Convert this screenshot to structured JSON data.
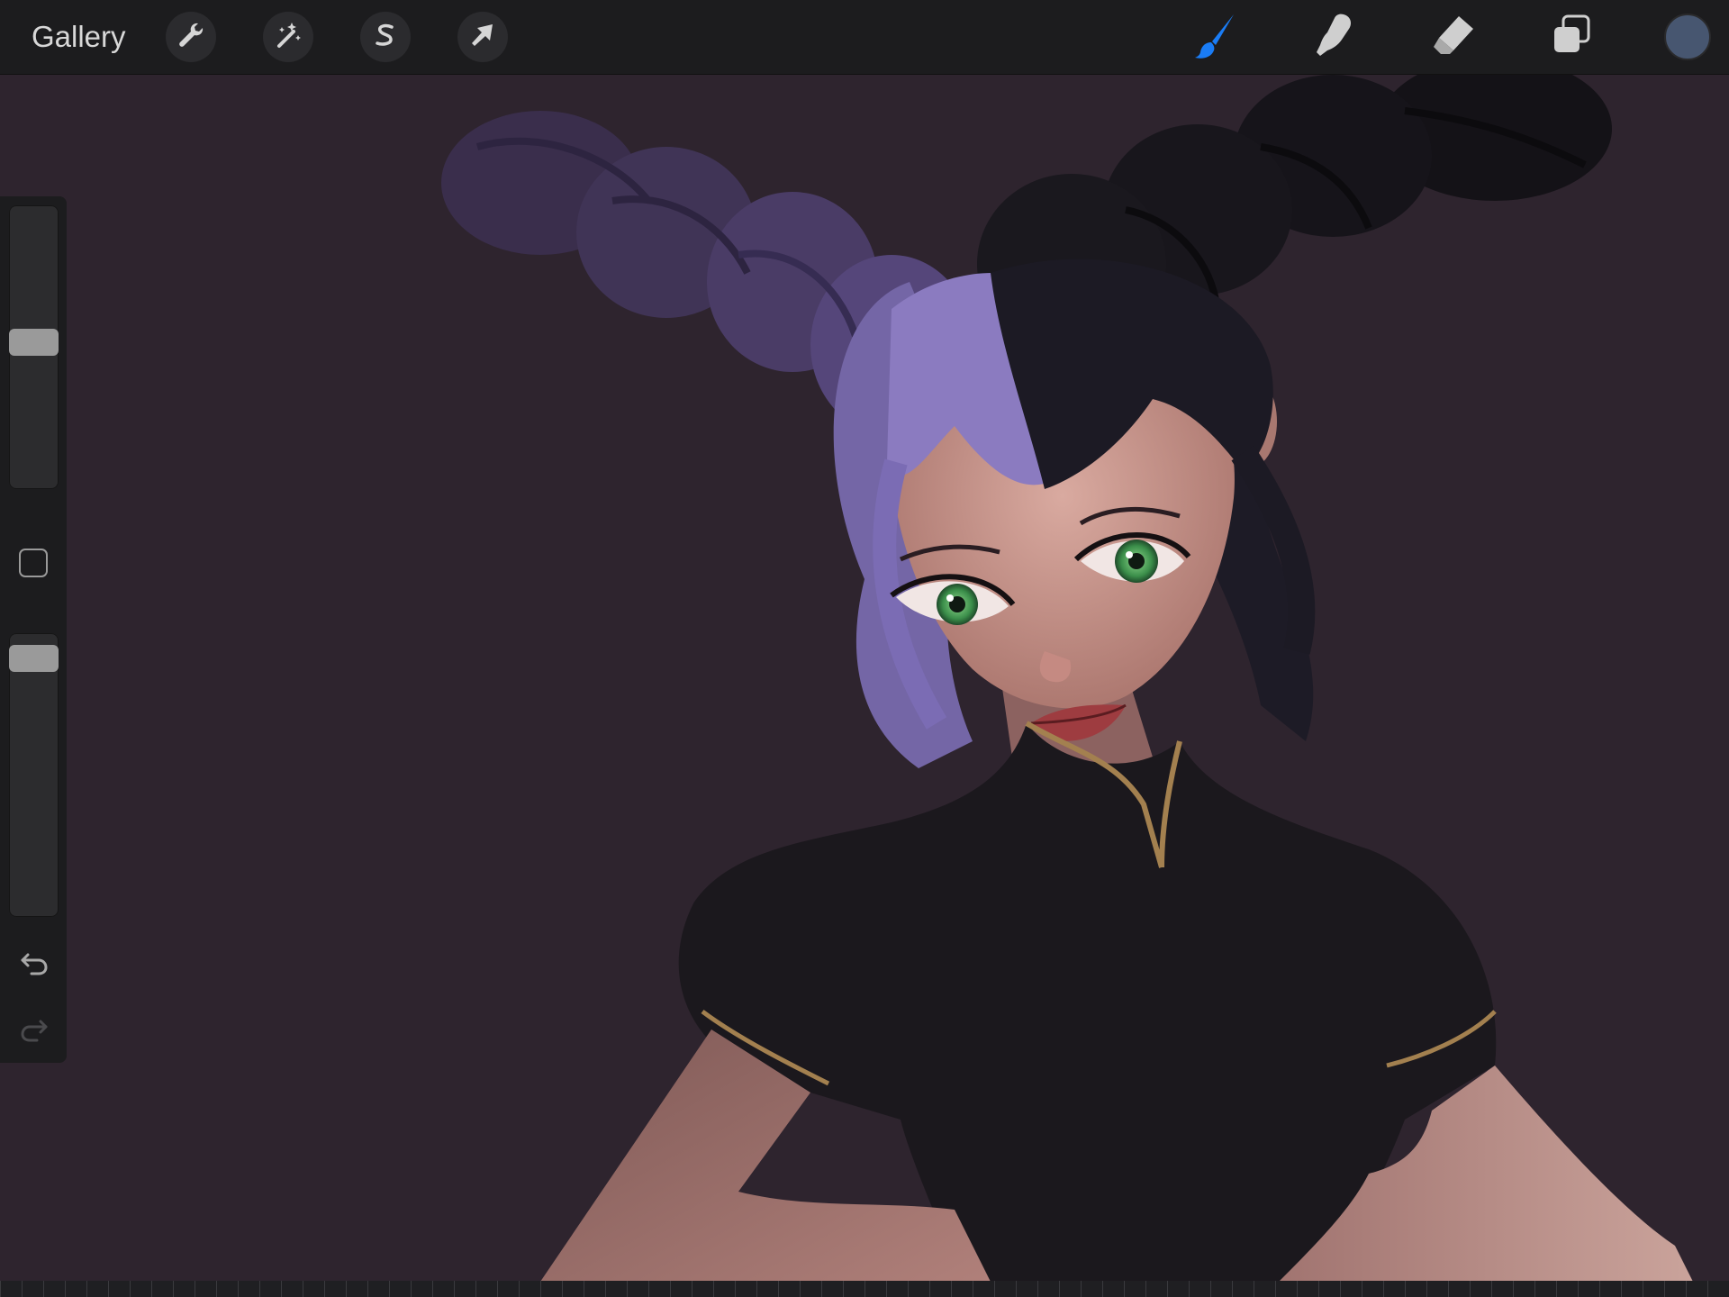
{
  "toolbar": {
    "gallery_label": "Gallery",
    "actions_icon": "wrench-icon",
    "adjustments_icon": "magic-wand-icon",
    "selection_icon": "selection-s-icon",
    "transform_icon": "arrow-cursor-icon",
    "brush_icon": "brush-icon",
    "smudge_icon": "smudge-finger-icon",
    "eraser_icon": "eraser-icon",
    "layers_icon": "layers-icon",
    "active_tool": "brush",
    "active_tool_color": "#1a7cf5",
    "current_color": "#475670"
  },
  "sidebar": {
    "brush_size_level": 0.52,
    "opacity_level": 0.97,
    "modify_icon": "square-outline-icon",
    "undo_icon": "undo-icon",
    "redo_icon": "redo-icon"
  },
  "canvas": {
    "background_color": "#2e242e"
  }
}
